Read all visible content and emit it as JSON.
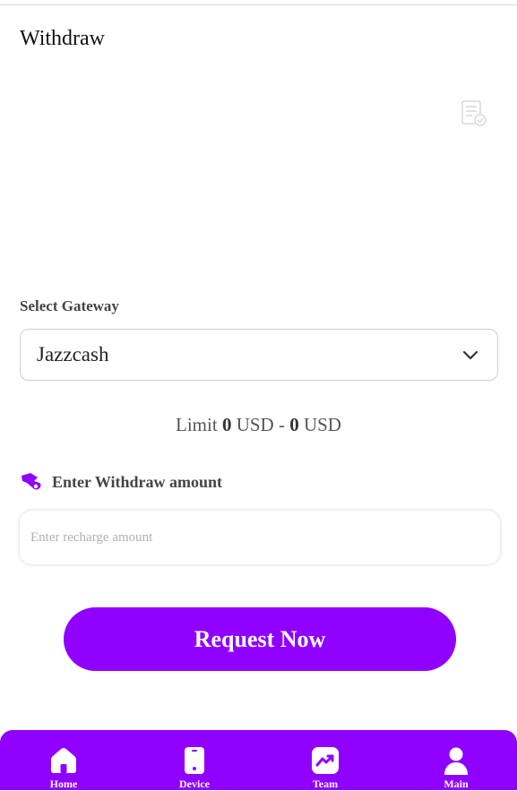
{
  "page": {
    "title": "Withdraw"
  },
  "gateway": {
    "label": "Select Gateway",
    "selected": "Jazzcash"
  },
  "limit": {
    "prefix": "Limit",
    "min": "0",
    "min_unit": "USD",
    "separator": "-",
    "max": "0",
    "max_unit": "USD"
  },
  "amount": {
    "label": "Enter Withdraw amount",
    "placeholder": "Enter recharge amount",
    "value": ""
  },
  "actions": {
    "request_label": "Request Now"
  },
  "nav": {
    "items": [
      {
        "label": "Home",
        "icon": "home-icon"
      },
      {
        "label": "Device",
        "icon": "device-icon"
      },
      {
        "label": "Team",
        "icon": "team-icon"
      },
      {
        "label": "Main",
        "icon": "user-icon"
      }
    ]
  },
  "colors": {
    "accent": "#8f00ff",
    "text_dark": "#111111",
    "text_muted": "#555555",
    "placeholder": "#b0b0b0",
    "border": "#cfcfcf"
  }
}
